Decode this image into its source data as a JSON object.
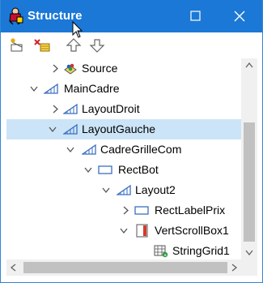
{
  "window": {
    "title": "Structure",
    "accent_color": "#1b78d6",
    "title_icon": "person-palette-icon",
    "buttons": {
      "maximize": "maximize-icon",
      "close": "close-icon"
    }
  },
  "toolbar": {
    "tools": [
      {
        "name": "new-item-icon"
      },
      {
        "name": "delete-item-icon"
      },
      {
        "name": "move-up-icon"
      },
      {
        "name": "move-down-icon"
      }
    ]
  },
  "tree": {
    "selection_color": "#cce4f7",
    "items": [
      {
        "label": "Source",
        "icon": "source-icon",
        "expanded": false,
        "has_children": true,
        "depth": 2
      },
      {
        "label": "MainCadre",
        "icon": "layout-icon",
        "expanded": true,
        "has_children": true,
        "depth": 1
      },
      {
        "label": "LayoutDroit",
        "icon": "layout-icon",
        "expanded": false,
        "has_children": true,
        "depth": 2
      },
      {
        "label": "LayoutGauche",
        "icon": "layout-icon",
        "expanded": true,
        "has_children": true,
        "depth": 2,
        "selected": true
      },
      {
        "label": "CadreGrilleCom",
        "icon": "layout-icon",
        "expanded": true,
        "has_children": true,
        "depth": 3
      },
      {
        "label": "RectBot",
        "icon": "rectangle-icon",
        "expanded": true,
        "has_children": true,
        "depth": 4
      },
      {
        "label": "Layout2",
        "icon": "layout-icon",
        "expanded": true,
        "has_children": true,
        "depth": 5
      },
      {
        "label": "RectLabelPrix",
        "icon": "rectangle-icon",
        "expanded": false,
        "has_children": true,
        "depth": 6
      },
      {
        "label": "VertScrollBox1",
        "icon": "scrollbox-icon",
        "expanded": true,
        "has_children": true,
        "depth": 6
      },
      {
        "label": "StringGrid1",
        "icon": "string-grid-icon",
        "expanded": false,
        "has_children": false,
        "depth": 7
      }
    ]
  },
  "scrollbars": {
    "vertical": {
      "up": "arrow-up-icon",
      "down": "arrow-down-icon"
    },
    "horizontal": {
      "left": "arrow-left-icon",
      "right": "arrow-right-icon"
    }
  }
}
